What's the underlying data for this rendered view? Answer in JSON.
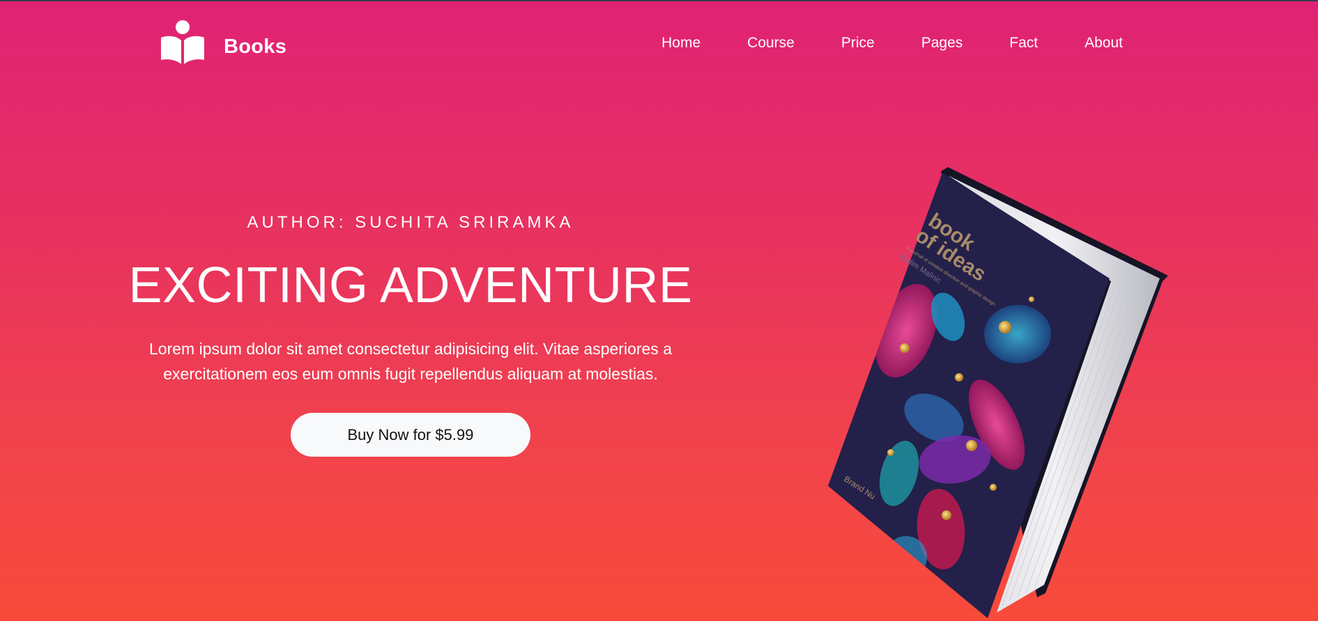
{
  "brand": {
    "name": "Books",
    "icon": "book-reader-icon"
  },
  "nav": {
    "items": [
      {
        "label": "Home"
      },
      {
        "label": "Course"
      },
      {
        "label": "Price"
      },
      {
        "label": "Pages"
      },
      {
        "label": "Fact"
      },
      {
        "label": "About"
      }
    ]
  },
  "hero": {
    "author": "AUTHOR: SUCHITA SRIRAMKA",
    "title": "EXCITING ADVENTURE",
    "description": "Lorem ipsum dolor sit amet consectetur adipisicing elit. Vitae asperiores a exercitationem eos eum omnis fugit repellendus aliquam at molestias.",
    "cta_label": "Buy Now for $5.99"
  },
  "book_cover": {
    "title_line1": "book",
    "title_line2": "of ideas",
    "subtitle": "A journal of creative direction and graphic design",
    "author": "Radim Malinic",
    "publisher": "Brand Nu"
  },
  "colors": {
    "gradient_top": "#e02274",
    "gradient_bottom": "#f84b3a",
    "button_bg": "#f8f9fb",
    "cover_bg": "#23204a"
  }
}
